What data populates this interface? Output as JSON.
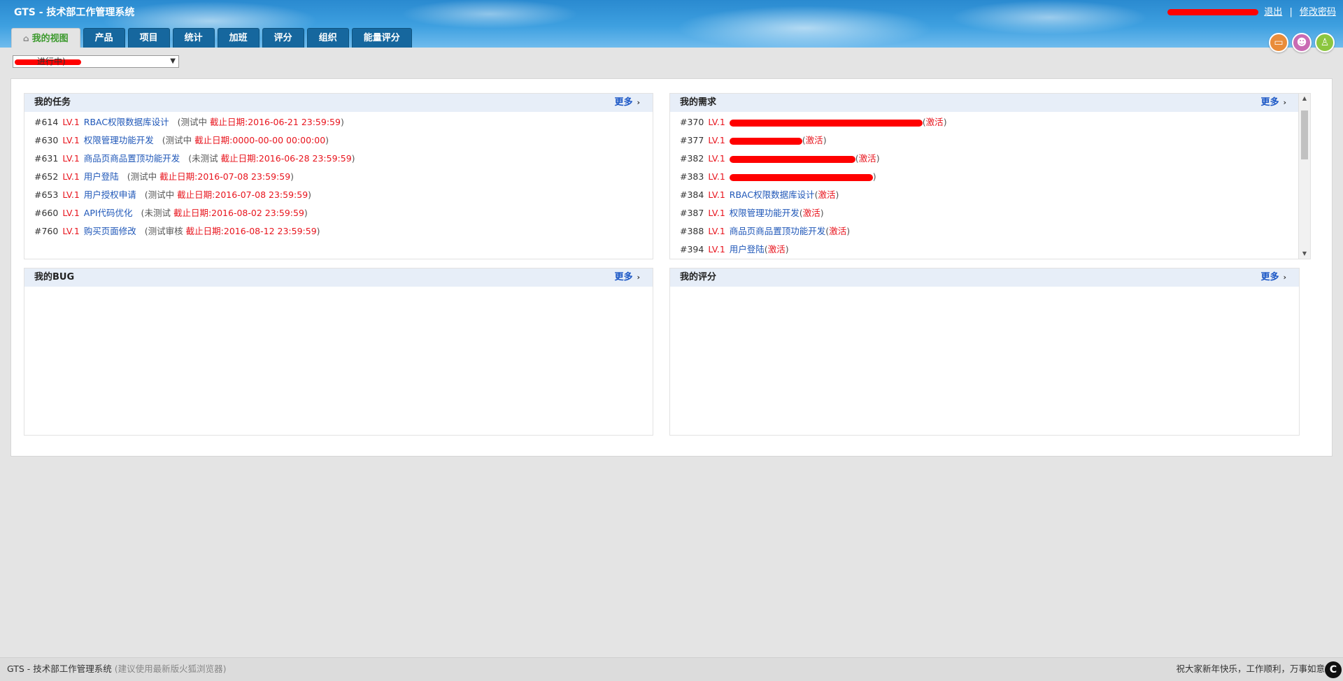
{
  "app": {
    "title": "GTS - 技术部工作管理系统"
  },
  "user_links": {
    "logout": "退出",
    "separator": "|",
    "change_password": "修改密码"
  },
  "tabs": [
    {
      "label": "我的视图",
      "active": true
    },
    {
      "label": "产品"
    },
    {
      "label": "项目"
    },
    {
      "label": "统计"
    },
    {
      "label": "加班"
    },
    {
      "label": "评分"
    },
    {
      "label": "组织"
    },
    {
      "label": "能量评分"
    }
  ],
  "header_icons": [
    {
      "icon": "monitor-icon",
      "color": "#e98c3a",
      "glyph": "▭"
    },
    {
      "icon": "user-icon",
      "color": "#c96bb3",
      "glyph": "☻"
    },
    {
      "icon": "teacher-icon",
      "color": "#8cc63f",
      "glyph": "♙"
    }
  ],
  "project_select": {
    "value": "进行中)",
    "caret": "▼"
  },
  "blocks": {
    "tasks": {
      "title": "我的任务",
      "more": "更多",
      "rows": [
        {
          "id": "#614",
          "lv": "LV.1",
          "name": "RBAC权限数据库设计",
          "open": "(",
          "status": "测试中",
          "deadline": "截止日期:2016-06-21 23:59:59",
          "close": ")"
        },
        {
          "id": "#630",
          "lv": "LV.1",
          "name": "权限管理功能开发",
          "open": "(",
          "status": "测试中",
          "deadline": "截止日期:0000-00-00 00:00:00",
          "close": ")"
        },
        {
          "id": "#631",
          "lv": "LV.1",
          "name": "商品页商品置顶功能开发",
          "open": "(",
          "status": "未测试",
          "deadline": "截止日期:2016-06-28 23:59:59",
          "close": ")"
        },
        {
          "id": "#652",
          "lv": "LV.1",
          "name": "用户登陆",
          "open": "(",
          "status": "测试中",
          "deadline": "截止日期:2016-07-08 23:59:59",
          "close": ")"
        },
        {
          "id": "#653",
          "lv": "LV.1",
          "name": "用户授权申请",
          "open": "(",
          "status": "测试中",
          "deadline": "截止日期:2016-07-08 23:59:59",
          "close": ")"
        },
        {
          "id": "#660",
          "lv": "LV.1",
          "name": "API代码优化",
          "open": "(",
          "status": "未测试",
          "deadline": "截止日期:2016-08-02 23:59:59",
          "close": ")"
        },
        {
          "id": "#760",
          "lv": "LV.1",
          "name": "购买页面修改",
          "open": "(",
          "status": "测试审核",
          "deadline": "截止日期:2016-08-12 23:59:59",
          "close": ")"
        }
      ]
    },
    "requirements": {
      "title": "我的需求",
      "more": "更多",
      "rows": [
        {
          "id": "#370",
          "lv": "LV.1",
          "name": "",
          "status": "激活",
          "open": "(",
          "close": ")"
        },
        {
          "id": "#377",
          "lv": "LV.1",
          "name": "",
          "status": "激活",
          "open": "(",
          "close": ")"
        },
        {
          "id": "#382",
          "lv": "LV.1",
          "name": "",
          "status": "激活",
          "open": "(",
          "close": ")"
        },
        {
          "id": "#383",
          "lv": "LV.1",
          "name": "",
          "status": "激活",
          "open": "(",
          "close": ")"
        },
        {
          "id": "#384",
          "lv": "LV.1",
          "name": "RBAC权限数据库设计",
          "status": "激活",
          "open": "(",
          "close": ")"
        },
        {
          "id": "#387",
          "lv": "LV.1",
          "name": "权限管理功能开发",
          "status": "激活",
          "open": "(",
          "close": ")"
        },
        {
          "id": "#388",
          "lv": "LV.1",
          "name": "商品页商品置顶功能开发",
          "status": "激活",
          "open": "(",
          "close": ")"
        },
        {
          "id": "#394",
          "lv": "LV.1",
          "name": "用户登陆",
          "status": "激活",
          "open": "(",
          "close": ")"
        }
      ]
    },
    "bugs": {
      "title": "我的BUG",
      "more": "更多"
    },
    "scores": {
      "title": "我的评分",
      "more": "更多"
    }
  },
  "footer": {
    "app_name": "GTS - 技术部工作管理系统",
    "hint": "(建议使用最新版火狐浏览器)",
    "greeting": "祝大家新年快乐，工作顺利，万事如意",
    "corner_icon": "C"
  }
}
